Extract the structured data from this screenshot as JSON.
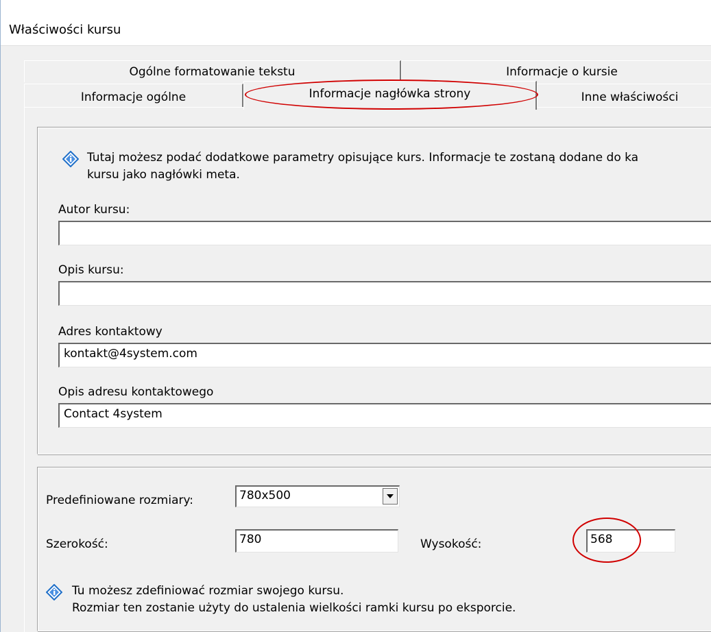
{
  "window": {
    "title": "Właściwości kursu"
  },
  "tabs": {
    "row1": [
      "Ogólne formatowanie tekstu",
      "Informacje o kursie"
    ],
    "row2": [
      "Informacje ogólne",
      "Informacje nagłówka strony",
      "Inne właściwości"
    ],
    "selected": "Informacje nagłówka strony"
  },
  "meta": {
    "info_text_line1": "Tutaj możesz podać dodatkowe parametry opisujące kurs. Informacje te zostaną dodane do ka",
    "info_text_line2": "kursu jako nagłówki meta.",
    "author_label": "Autor kursu:",
    "author_value": "",
    "description_label": "Opis kursu:",
    "description_value": "",
    "contact_label": "Adres kontaktowy",
    "contact_value": "kontakt@4system.com",
    "contact_desc_label": "Opis adresu kontaktowego",
    "contact_desc_value": "Contact 4system"
  },
  "size": {
    "predefined_label": "Predefiniowane rozmiary:",
    "predefined_value": "780x500",
    "width_label": "Szerokość:",
    "width_value": "780",
    "height_label": "Wysokość:",
    "height_value": "568",
    "info_line1": "Tu możesz zdefiniować rozmiar swojego kursu.",
    "info_line2": "Rozmiar ten zostanie użyty do ustalenia wielkości ramki kursu po eksporcie."
  },
  "colors": {
    "annotation": "#d00000",
    "icon_blue": "#1f6fc8"
  }
}
